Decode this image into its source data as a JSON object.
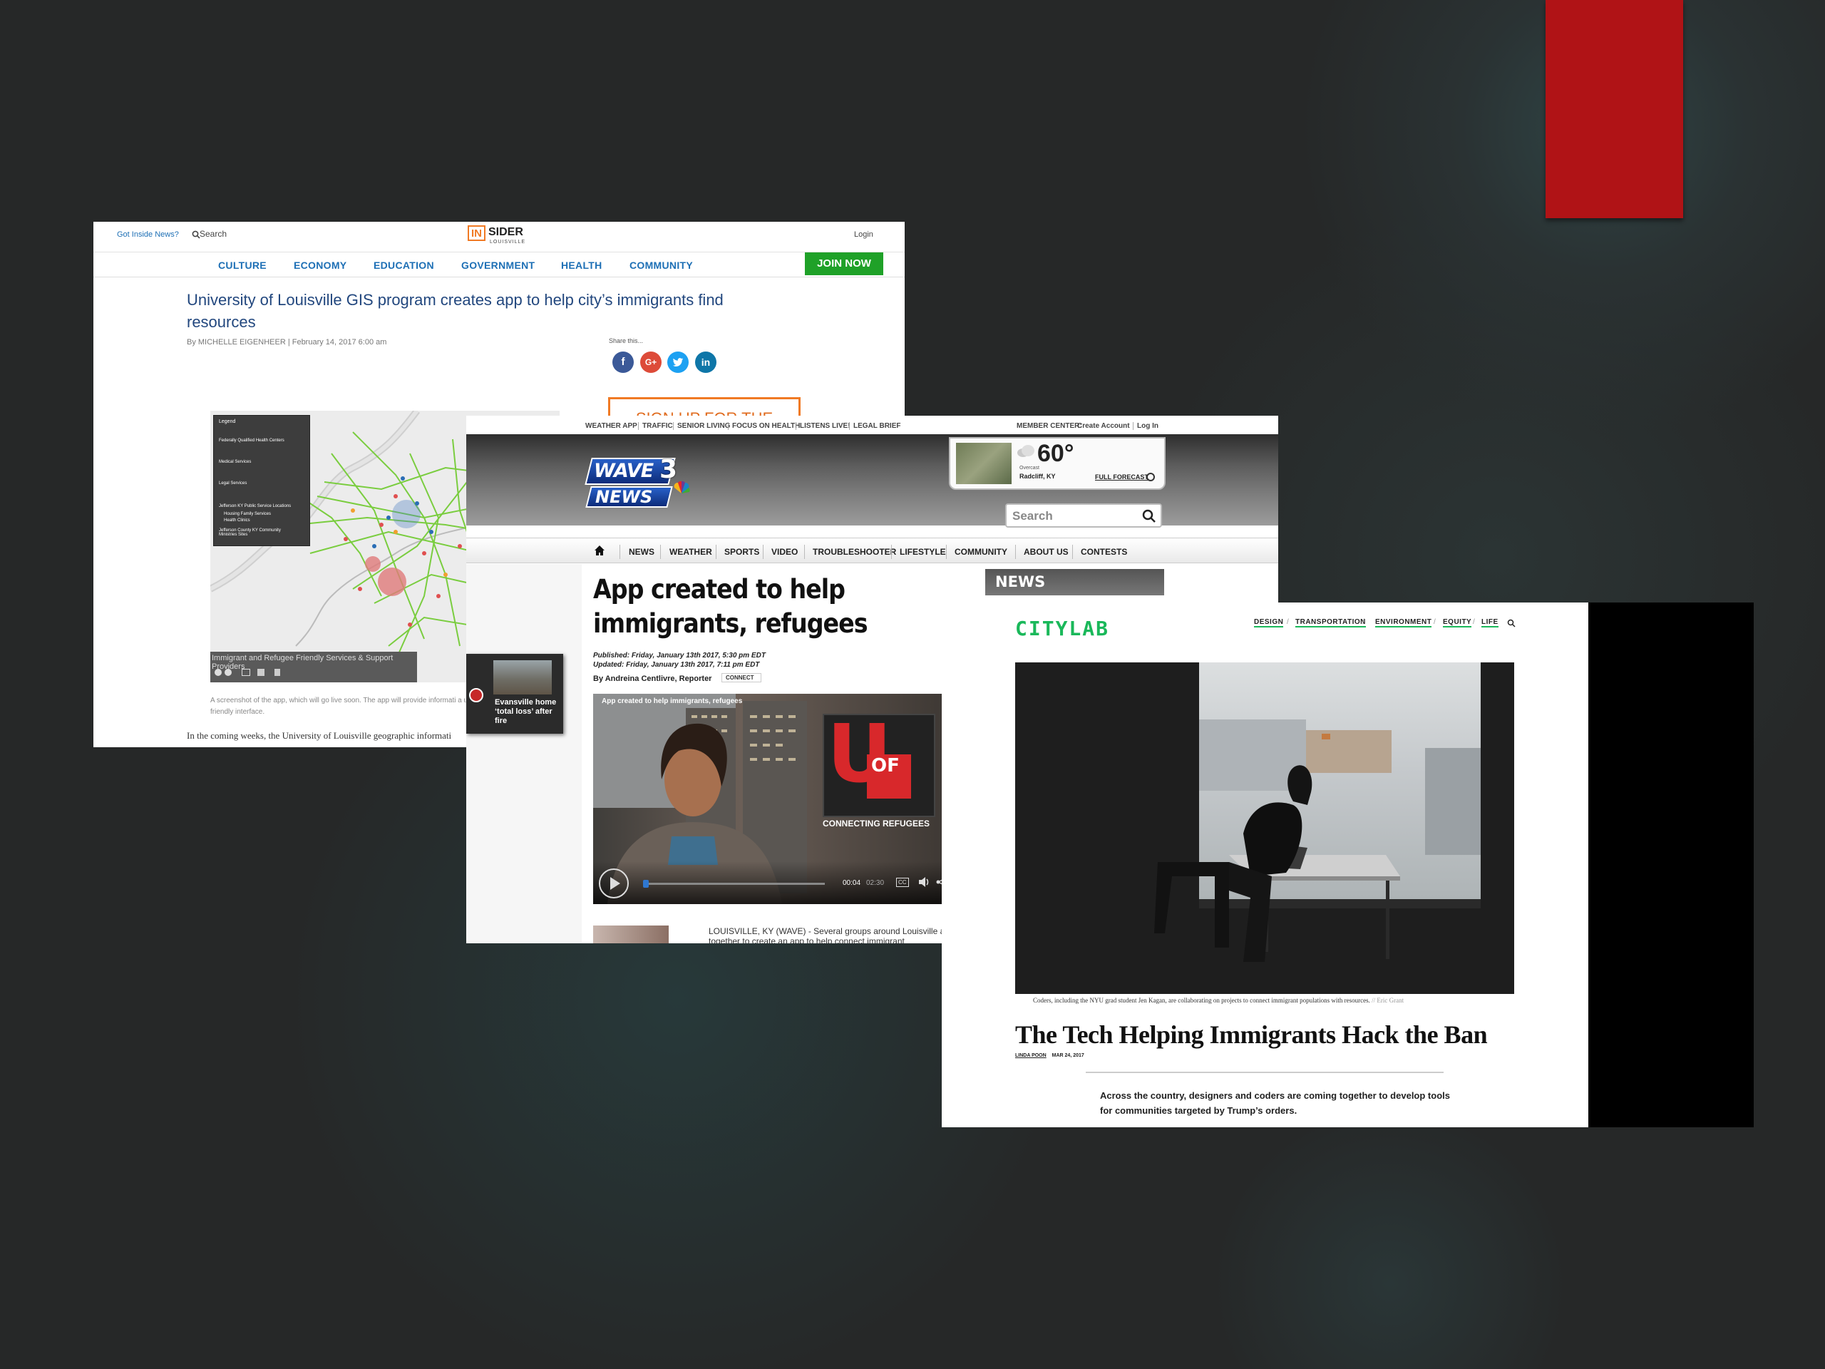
{
  "accent_color": "#b01316",
  "insider": {
    "got_news": "Got Inside News?",
    "search": "Search",
    "logo_in": "IN",
    "logo_sider": "SIDER",
    "logo_sub": "LOUISVILLE",
    "login": "Login",
    "nav": [
      "CULTURE",
      "ECONOMY",
      "EDUCATION",
      "GOVERNMENT",
      "HEALTH",
      "COMMUNITY"
    ],
    "join": "JOIN NOW",
    "title": "University of Louisville GIS program creates app to help city’s immigrants find resources",
    "byline": "By MICHELLE EIGENHEER | February 14, 2017 6:00 am",
    "share_label": "Share this...",
    "signup": "SIGN UP FOR THE",
    "map_legend": {
      "title": "Legend",
      "items": [
        "Federally Qualified Health Centers",
        "Medical Services",
        "Legal Services",
        "Jefferson KY Public Service Locations",
        "Housing Family Services",
        "Health Clinics",
        "Jefferson County KY Community Ministries Sites"
      ]
    },
    "map_caption_bar": "Immigrant and Refugee Friendly Services & Support Providers",
    "caption": "A screenshot of the app, which will go live soon. The app will provide informati a user-friendly interface.",
    "body": "In the coming weeks, the University of Louisville geographic informati"
  },
  "wave": {
    "top_links": [
      "WEATHER APP",
      "TRAFFIC",
      "SENIOR LIVING",
      "FOCUS ON HEALTH",
      "LISTENS LIVE!",
      "LEGAL BRIEF"
    ],
    "member_center": "MEMBER CENTER:",
    "create_account": "Create Account",
    "log_in": "Log In",
    "logo_top": "WAVE",
    "logo_bottom": "NEWS",
    "logo_num": "3",
    "weather": {
      "temp": "60°",
      "cond": "Overcast",
      "city": "Radcliff, KY",
      "forecast": "FULL FORECAST"
    },
    "search_placeholder": "Search",
    "nav": [
      "NEWS",
      "WEATHER",
      "SPORTS",
      "VIDEO",
      "TROUBLESHOOTER",
      "LIFESTYLE",
      "COMMUNITY",
      "ABOUT US",
      "CONTESTS"
    ],
    "title_line1": "App created to help",
    "title_line2": "immigrants, refugees",
    "published": "Published: Friday, January 13th 2017, 5:30 pm EDT",
    "updated": "Updated: Friday, January 13th 2017, 7:11 pm EDT",
    "byline": "By Andreina Centlivre, Reporter",
    "connect": "CONNECT",
    "video": {
      "title": "App created to help immigrants, refugees",
      "overlay": "CONNECTING REFUGEES",
      "ul_letter": "U",
      "of": "OF",
      "time": "00:04",
      "duration": "02:30",
      "cc": "CC"
    },
    "news_header": "NEWS",
    "article_text": "LOUISVILLE, KY (WAVE) - Several groups around Louisville are coming together to create an app to help connect immigrant",
    "popup": "Evansville home ‘total loss’ after fire"
  },
  "citylab": {
    "logo": "CITYLAB",
    "nav": [
      "DESIGN",
      "TRANSPORTATION",
      "ENVIRONMENT",
      "EQUITY",
      "LIFE"
    ],
    "caption": "Coders, including the NYU grad student Jen Kagan, are collaborating on projects to connect immigrant populations with resources.",
    "credit": "// Eric Grant",
    "headline": "The Tech Helping Immigrants Hack the Ban",
    "author": "LINDA POON",
    "date": "MAR 24, 2017",
    "dek": "Across the country, designers and coders are coming together to develop tools for communities targeted by Trump’s orders.",
    "accent": "#1ab85a"
  }
}
